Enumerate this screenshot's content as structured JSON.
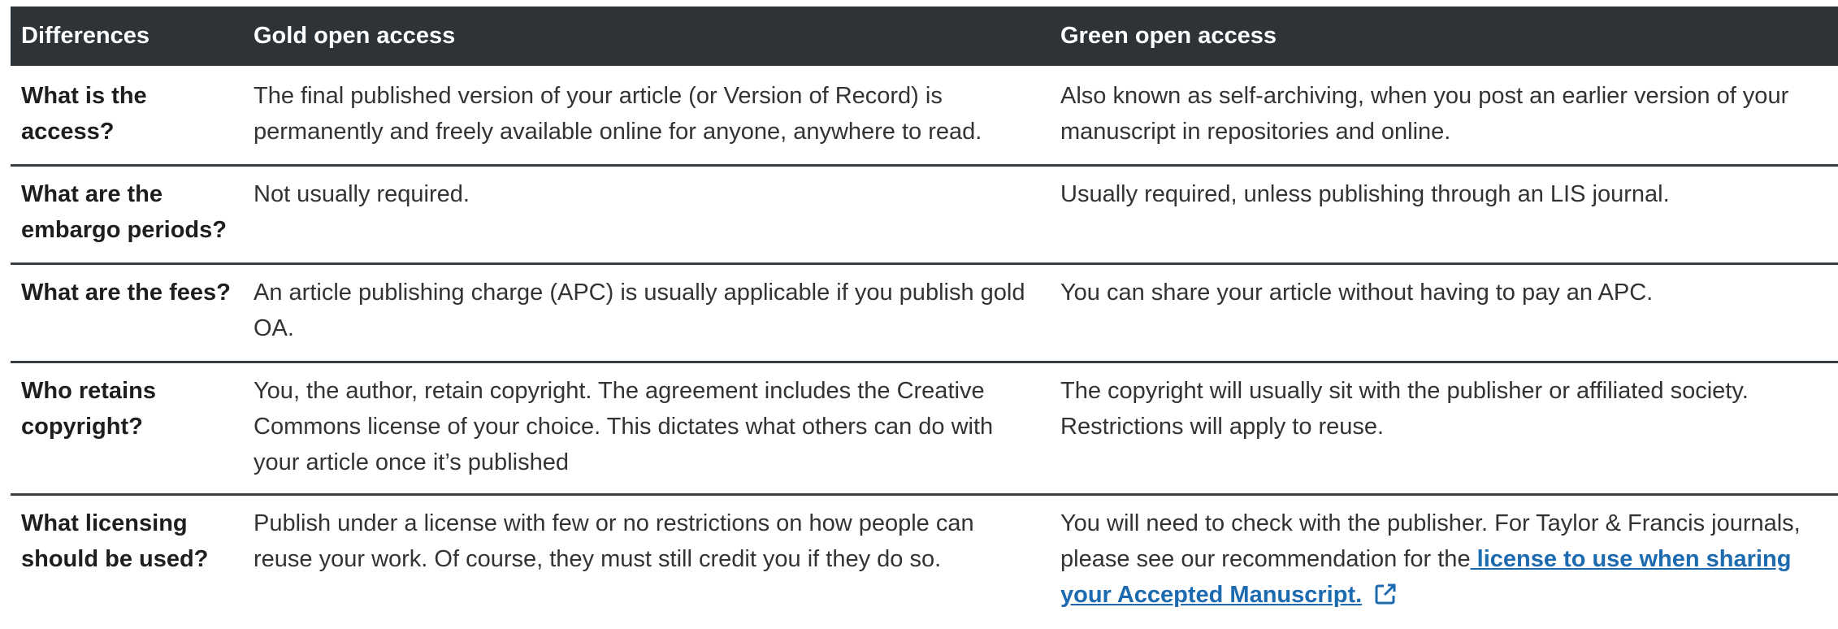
{
  "table": {
    "headers": [
      "Differences",
      "Gold open access",
      "Green open access"
    ],
    "rows": [
      {
        "question": "What is the access?",
        "gold": "The final published version of your article (or Version of Record) is permanently and freely available online for anyone, anywhere to read.",
        "green": "Also known as self-archiving, when you post an earlier version of your manuscript in repositories and online."
      },
      {
        "question": "What are the embargo periods?",
        "gold": "Not usually required.",
        "green": "Usually required, unless publishing through an LIS journal."
      },
      {
        "question": "What are the fees?",
        "gold": "An article publishing charge (APC) is usually applicable if you publish gold OA.",
        "green": "You can share your article without having to pay an APC."
      },
      {
        "question": "Who retains copyright?",
        "gold": "You, the author, retain copyright. The agreement includes the Creative Commons license of your choice. This dictates what others can do with your article once it’s published",
        "green": "The copyright will usually sit with the publisher or affiliated society. Restrictions will apply to reuse."
      },
      {
        "question": "What licensing should be used?",
        "gold": "Publish under a license with few or no restrictions on how people can reuse your work. Of course, they must still credit you if they do so.",
        "green_prefix": "You will need to check with the publisher. For Taylor & Francis journals, please see our recommendation for the",
        "green_link": " license to use when sharing your Accepted Manuscript."
      }
    ]
  },
  "icons": {
    "external_link": "external-link-icon"
  },
  "colors": {
    "header_bg": "#2e3338",
    "link": "#1c6ab0",
    "rule": "#3a3f44"
  }
}
